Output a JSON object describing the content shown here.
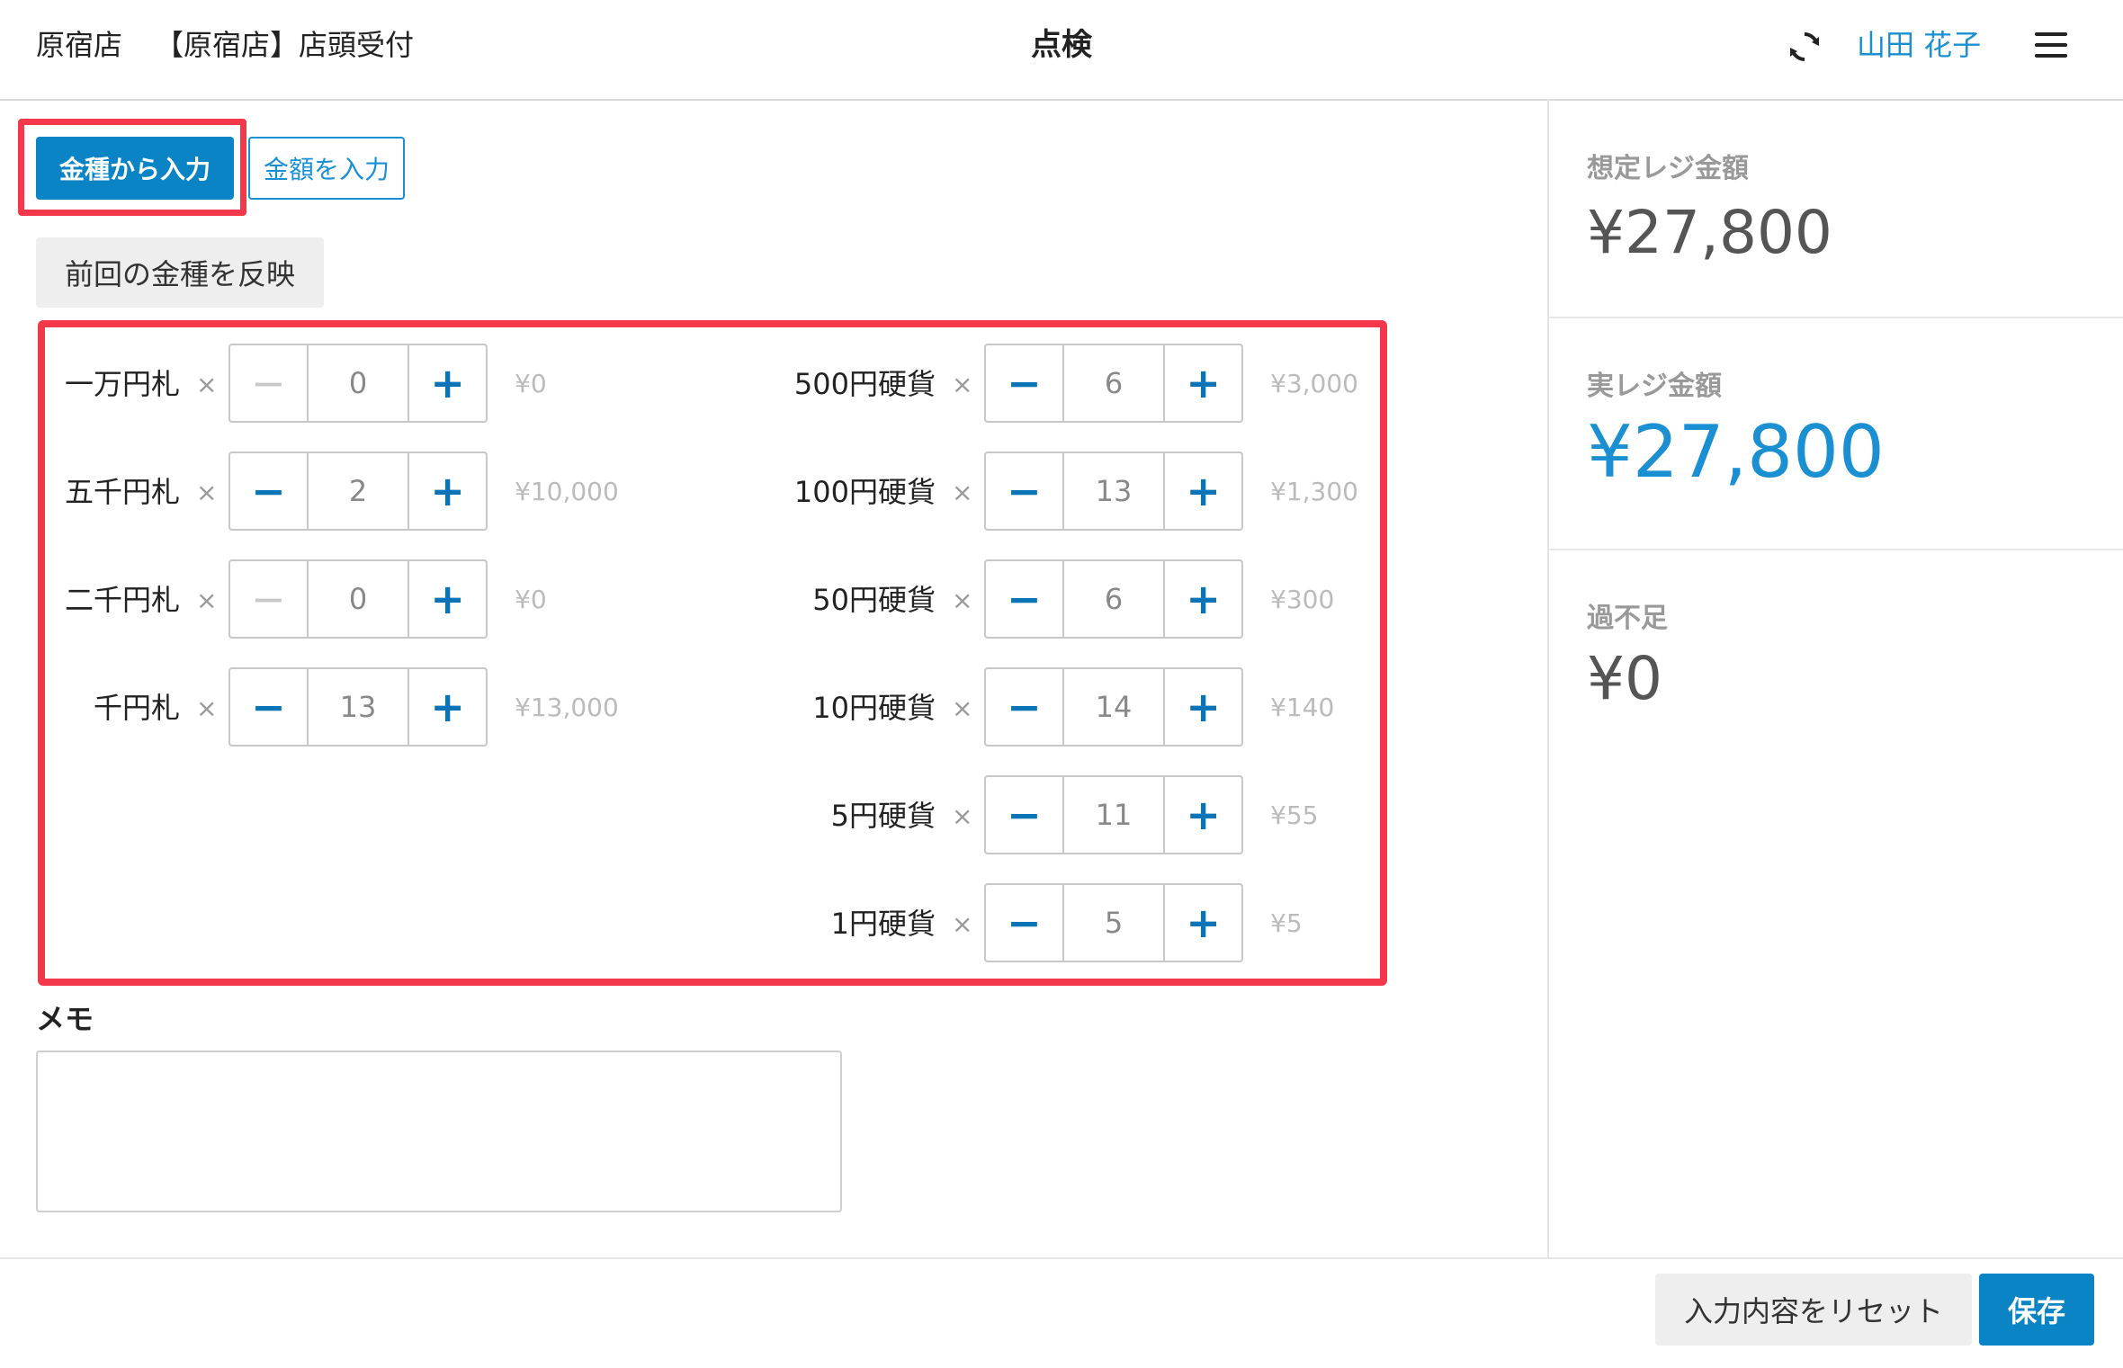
{
  "header": {
    "store": "原宿店",
    "reception": "【原宿店】店頭受付",
    "title": "点検",
    "user": "山田 花子",
    "sync_icon": "sync-icon",
    "menu_icon": "hamburger-menu-icon"
  },
  "mode": {
    "denomination_label": "金種から入力",
    "amount_label": "金額を入力",
    "reflect_label": "前回の金種を反映"
  },
  "bills": [
    {
      "label": "一万円札",
      "count": "0",
      "subtotal": "¥0",
      "minus_disabled": true
    },
    {
      "label": "五千円札",
      "count": "2",
      "subtotal": "¥10,000",
      "minus_disabled": false
    },
    {
      "label": "二千円札",
      "count": "0",
      "subtotal": "¥0",
      "minus_disabled": true
    },
    {
      "label": "千円札",
      "count": "13",
      "subtotal": "¥13,000",
      "minus_disabled": false
    }
  ],
  "coins": [
    {
      "label": "500円硬貨",
      "count": "6",
      "subtotal": "¥3,000",
      "minus_disabled": false
    },
    {
      "label": "100円硬貨",
      "count": "13",
      "subtotal": "¥1,300",
      "minus_disabled": false
    },
    {
      "label": "50円硬貨",
      "count": "6",
      "subtotal": "¥300",
      "minus_disabled": false
    },
    {
      "label": "10円硬貨",
      "count": "14",
      "subtotal": "¥140",
      "minus_disabled": false
    },
    {
      "label": "5円硬貨",
      "count": "11",
      "subtotal": "¥55",
      "minus_disabled": false
    },
    {
      "label": "1円硬貨",
      "count": "5",
      "subtotal": "¥5",
      "minus_disabled": false
    }
  ],
  "symbols": {
    "times": "×",
    "minus": "−",
    "plus": "+"
  },
  "memo": {
    "label": "メモ",
    "value": ""
  },
  "summary": {
    "expected_label": "想定レジ金額",
    "expected_value": "¥27,800",
    "actual_label": "実レジ金額",
    "actual_value": "¥27,800",
    "diff_label": "過不足",
    "diff_value": "¥0"
  },
  "footer": {
    "reset_label": "入力内容をリセット",
    "save_label": "保存"
  },
  "colors": {
    "accent": "#0b84c6",
    "highlight": "#f2384a"
  }
}
